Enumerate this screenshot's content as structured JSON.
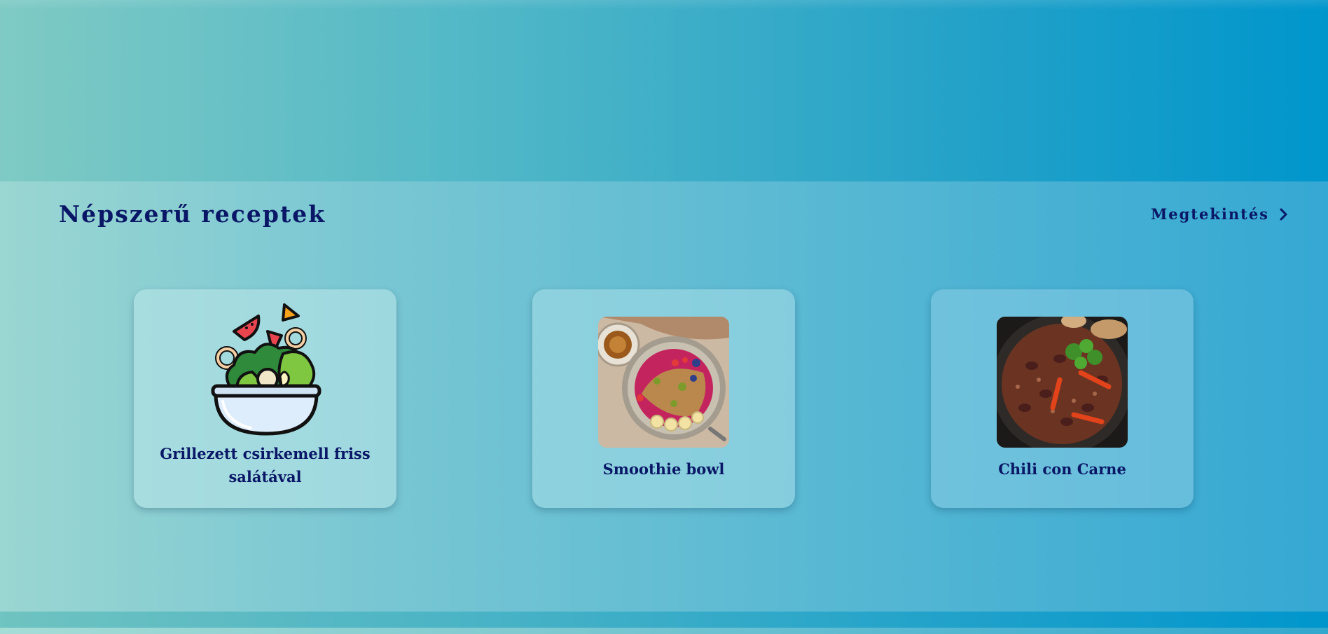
{
  "section": {
    "title": "Népszerű receptek",
    "view_link_label": "Megtekintés"
  },
  "cards": [
    {
      "title": "Grillezett csirkemell friss salátával",
      "image": "salad-bowl-icon"
    },
    {
      "title": "Smoothie bowl",
      "image": "smoothie-bowl-photo"
    },
    {
      "title": "Chili con Carne",
      "image": "chili-con-carne-photo"
    }
  ],
  "colors": {
    "text": "#0a1766",
    "accent_teal": "#7fcac4",
    "accent_blue": "#0096cc"
  }
}
